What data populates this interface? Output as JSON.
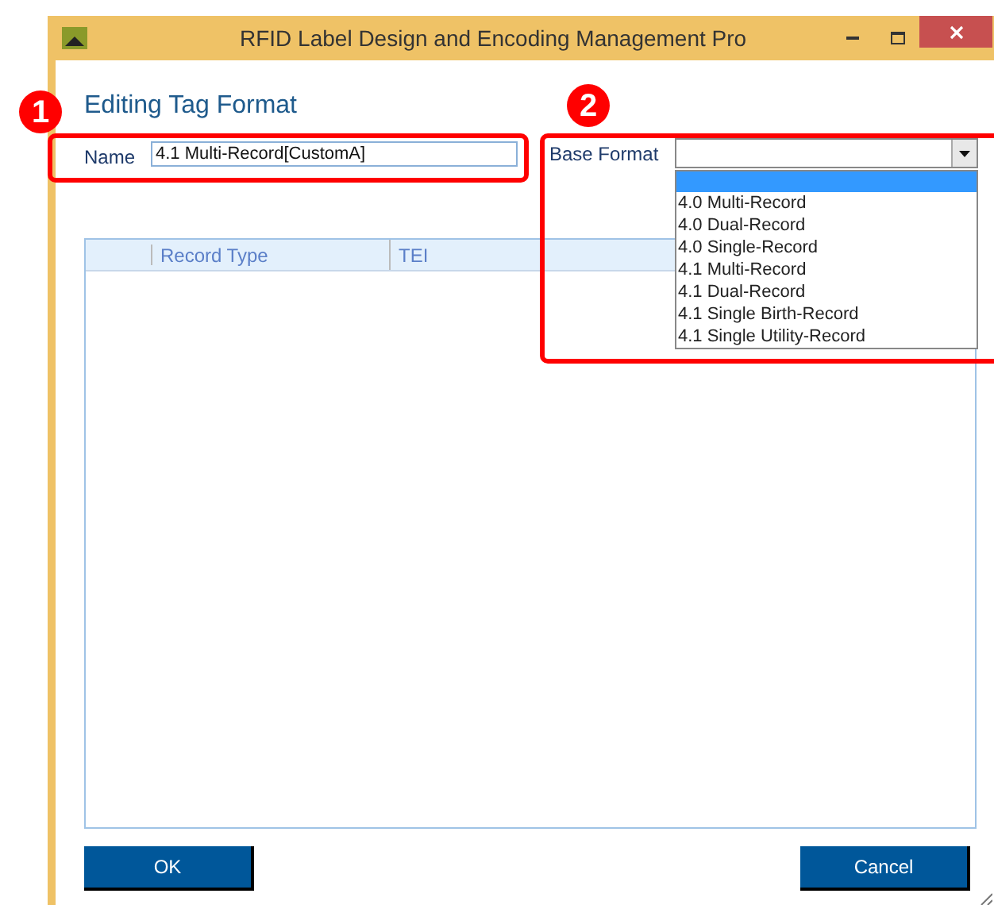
{
  "window": {
    "title": "RFID Label Design and Encoding Management Pro"
  },
  "heading": "Editing Tag Format",
  "name_field": {
    "label": "Name",
    "value": "4.1 Multi-Record[CustomA]"
  },
  "base_format": {
    "label": "Base Format",
    "expanded": true,
    "blank_option_selected": true,
    "options": [
      {
        "label": "4.0 Multi-Record",
        "selected": false
      },
      {
        "label": "4.0 Dual-Record",
        "selected": false
      },
      {
        "label": "4.0 Single-Record",
        "selected": false
      },
      {
        "label": "4.1 Multi-Record",
        "selected": false
      },
      {
        "label": "4.1 Dual-Record",
        "selected": false
      },
      {
        "label": "4.1 Single Birth-Record",
        "selected": false
      },
      {
        "label": "4.1 Single Utility-Record",
        "selected": false
      }
    ]
  },
  "table": {
    "columns": [
      "Record Type",
      "TEI"
    ]
  },
  "buttons": [
    "OK",
    "Cancel"
  ],
  "callouts": [
    {
      "number": "1"
    },
    {
      "number": "2"
    }
  ]
}
